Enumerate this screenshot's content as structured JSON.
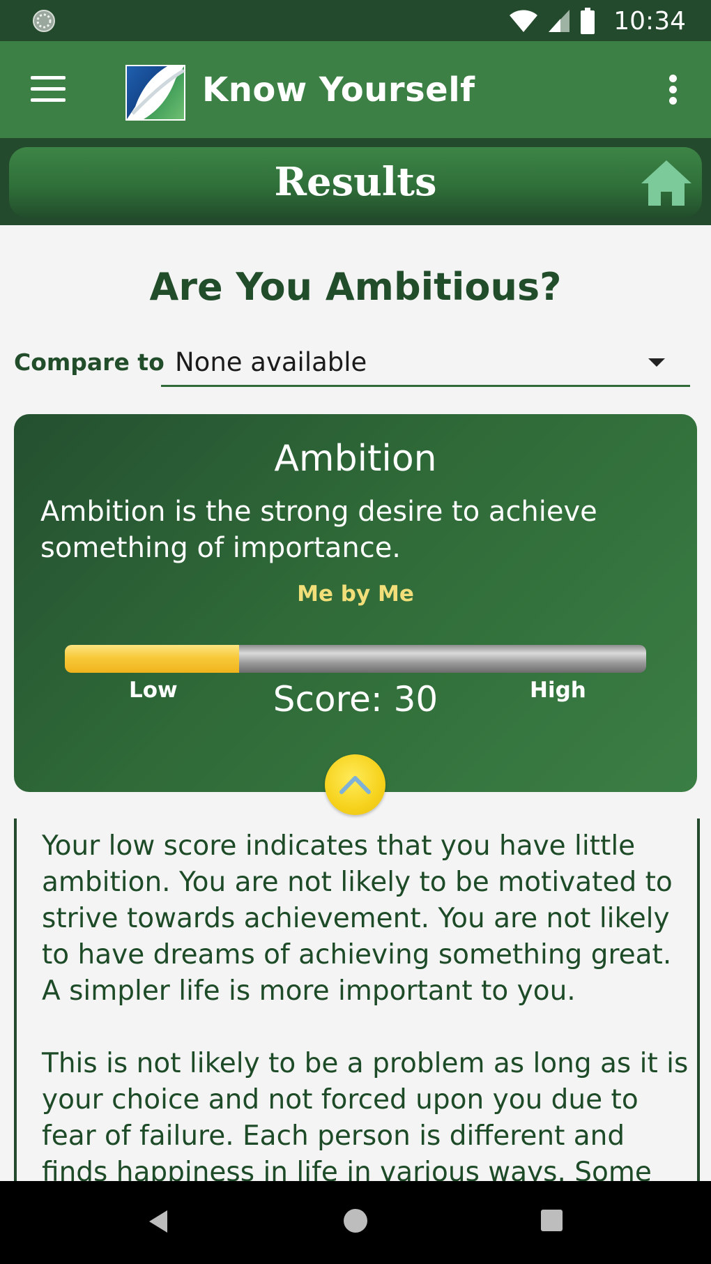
{
  "status_bar": {
    "time": "10:34"
  },
  "app_bar": {
    "title": "Know Yourself"
  },
  "results_header": {
    "title": "Results"
  },
  "quiz": {
    "title": "Are You Ambitious?"
  },
  "compare": {
    "label": "Compare to",
    "selected": "None available"
  },
  "trait_card": {
    "name": "Ambition",
    "description": "Ambition is the strong desire to achieve something of importance.",
    "rater": "Me by Me",
    "low_label": "Low",
    "high_label": "High",
    "score_text": "Score: 30",
    "score_value": 30,
    "score_fraction": 0.3
  },
  "result": {
    "text": "Your low score indicates that you have little ambition. You are not likely to be motivated to strive towards achievement. You are not likely to have dreams of achieving something great. A simpler life is more important to you.\n\nThis is not likely to be a problem as long as it is your choice and not forced upon you due to fear of failure. Each person is different and finds happiness in life in various ways. Some"
  },
  "icons": {
    "menu": "hamburger-menu-icon",
    "overflow": "more-vert-icon",
    "home": "home-icon",
    "collapse": "chevron-up-icon",
    "wifi": "wifi-icon",
    "signal": "signal-icon",
    "battery": "battery-icon"
  },
  "colors": {
    "primary_dark": "#234a2c",
    "primary": "#3d8045",
    "accent_yellow": "#f6d21c",
    "rater_yellow": "#f2df7a",
    "home_icon_green": "#7cc99a"
  }
}
